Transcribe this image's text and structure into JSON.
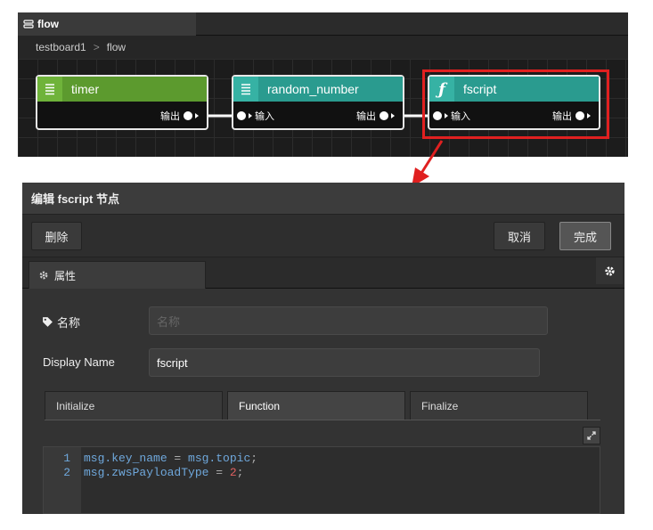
{
  "flow_editor": {
    "tab_label": "flow",
    "breadcrumb": {
      "parent": "testboard1",
      "current": "flow"
    },
    "nodes": [
      {
        "label": "timer",
        "color": "#5c9a2e",
        "output": "输出"
      },
      {
        "label": "random_number",
        "color": "#2a9b8f",
        "input": "输入",
        "output": "输出"
      },
      {
        "label": "fscript",
        "color": "#2a9b8f",
        "icon": "ƒ",
        "input": "输入",
        "output": "输出"
      }
    ],
    "highlight_color": "#e02020"
  },
  "edit_panel": {
    "title": "编辑 fscript 节点",
    "toolbar": {
      "delete_label": "删除",
      "cancel_label": "取消",
      "done_label": "完成"
    },
    "tabs": {
      "properties_label": "属性"
    },
    "form": {
      "name_label": "名称",
      "name_placeholder": "名称",
      "display_name_label": "Display Name",
      "display_name_value": "fscript"
    },
    "sub_tabs": {
      "initialize": "Initialize",
      "function": "Function",
      "finalize": "Finalize"
    },
    "code": {
      "lines": [
        {
          "num": "1",
          "var1": "msg.key_name",
          "op": " = ",
          "var2": "msg.topic",
          "end": ";"
        },
        {
          "num": "2",
          "var1": "msg.zwsPayloadType",
          "op": " = ",
          "val": "2",
          "end": ";"
        }
      ]
    }
  }
}
